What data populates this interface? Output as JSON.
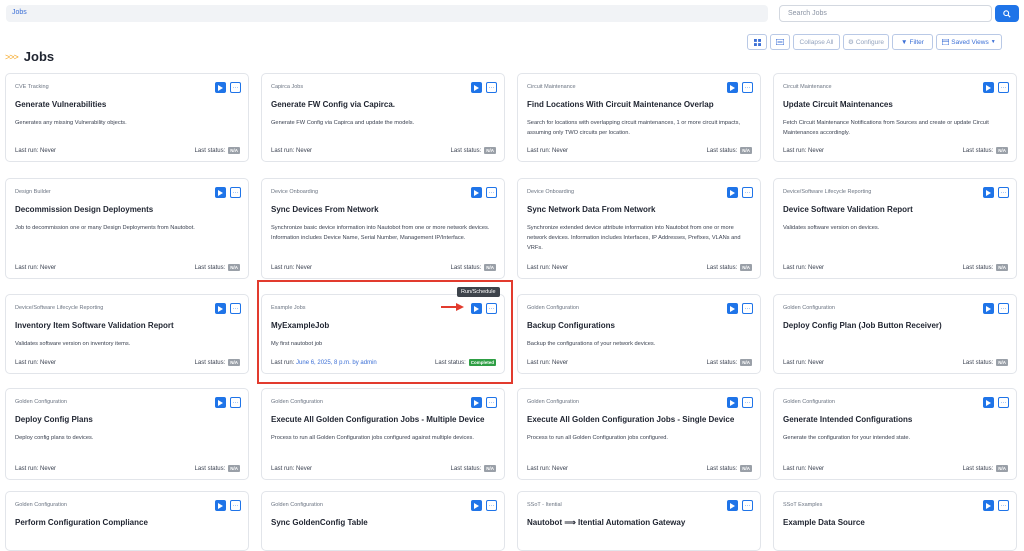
{
  "breadcrumb": "Jobs",
  "search": {
    "placeholder": "Search Jobs"
  },
  "page": {
    "chevrons": ">>>",
    "title": "Jobs"
  },
  "toolbar": {
    "collapse_all": "Collapse All",
    "configure": "Configure",
    "filter": "Filter",
    "saved_views": "Saved Views"
  },
  "tooltip": "Run/Schedule",
  "labels": {
    "last_run": "Last run:",
    "last_status": "Last status:"
  },
  "cards": [
    {
      "category": "CVE Tracking",
      "name": "Generate Vulnerabilities",
      "description": "Generates any missing Vulnerability objects.",
      "last_run": "Never",
      "status": "N/A"
    },
    {
      "category": "Capirca Jobs",
      "name": "Generate FW Config via Capirca.",
      "description": "Generate FW Config via Capirca and update the models.",
      "last_run": "Never",
      "status": "N/A"
    },
    {
      "category": "Circuit Maintenance",
      "name": "Find Locations With Circuit Maintenance Overlap",
      "description": "Search for locations with overlapping circuit maintenances, 1 or more circuit impacts, assuming only TWO circuits per location.",
      "last_run": "Never",
      "status": "N/A"
    },
    {
      "category": "Circuit Maintenance",
      "name": "Update Circuit Maintenances",
      "description": "Fetch Circuit Maintenance Notifications from Sources and create or update Circuit Maintenances accordingly.",
      "last_run": "Never",
      "status": "N/A"
    },
    {
      "category": "Design Builder",
      "name": "Decommission Design Deployments",
      "description": "Job to decommission one or many Design Deployments from Nautobot.",
      "last_run": "Never",
      "status": "N/A"
    },
    {
      "category": "Device Onboarding",
      "name": "Sync Devices From Network",
      "description": "Synchronize basic device information into Nautobot from one or more network devices. Information includes Device Name, Serial Number, Management IP/Interface.",
      "last_run": "Never",
      "status": "N/A"
    },
    {
      "category": "Device Onboarding",
      "name": "Sync Network Data From Network",
      "description": "Synchronize extended device attribute information into Nautobot from one or more network devices. Information includes Interfaces, IP Addresses, Prefixes, VLANs and VRFs.",
      "last_run": "Never",
      "status": "N/A"
    },
    {
      "category": "Device/Software Lifecycle Reporting",
      "name": "Device Software Validation Report",
      "description": "Validates software version on devices.",
      "last_run": "Never",
      "status": "N/A"
    },
    {
      "category": "Device/Software Lifecycle Reporting",
      "name": "Inventory Item Software Validation Report",
      "description": "Validates software version on inventory items.",
      "last_run": "Never",
      "status": "N/A"
    },
    {
      "category": "Example Jobs",
      "name": "MyExampleJob",
      "description": "My first nautobot job",
      "last_run": "June 6, 2025, 8 p.m. by admin",
      "status": "Completed"
    },
    {
      "category": "Golden Configuration",
      "name": "Backup Configurations",
      "description": "Backup the configurations of your network devices.",
      "last_run": "Never",
      "status": "N/A"
    },
    {
      "category": "Golden Configuration",
      "name": "Deploy Config Plan (Job Button Receiver)",
      "description": "",
      "last_run": "Never",
      "status": "N/A"
    },
    {
      "category": "Golden Configuration",
      "name": "Deploy Config Plans",
      "description": "Deploy config plans to devices.",
      "last_run": "Never",
      "status": "N/A"
    },
    {
      "category": "Golden Configuration",
      "name": "Execute All Golden Configuration Jobs - Multiple Device",
      "description": "Process to run all Golden Configuration jobs configured against multiple devices.",
      "last_run": "Never",
      "status": "N/A"
    },
    {
      "category": "Golden Configuration",
      "name": "Execute All Golden Configuration Jobs - Single Device",
      "description": "Process to run all Golden Configuration jobs configured.",
      "last_run": "Never",
      "status": "N/A"
    },
    {
      "category": "Golden Configuration",
      "name": "Generate Intended Configurations",
      "description": "Generate the configuration for your intended state.",
      "last_run": "Never",
      "status": "N/A"
    },
    {
      "category": "Golden Configuration",
      "name": "Perform Configuration Compliance",
      "description": "",
      "last_run": "",
      "status": ""
    },
    {
      "category": "Golden Configuration",
      "name": "Sync GoldenConfig Table",
      "description": "",
      "last_run": "",
      "status": ""
    },
    {
      "category": "SSoT - Itential",
      "name": "Nautobot ⟹ Itential Automation Gateway",
      "description": "",
      "last_run": "",
      "status": ""
    },
    {
      "category": "SSoT Examples",
      "name": "Example Data Source",
      "description": "",
      "last_run": "",
      "status": ""
    }
  ]
}
